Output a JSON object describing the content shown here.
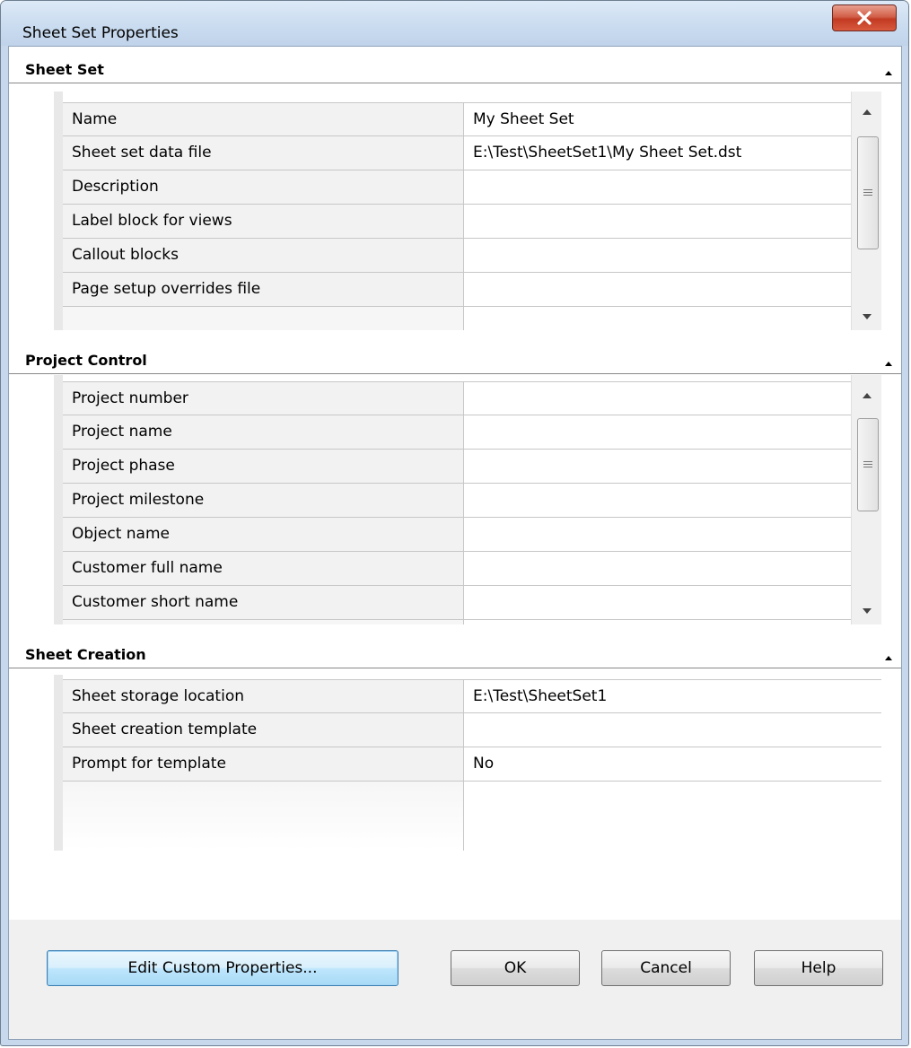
{
  "window": {
    "title": "Sheet Set Properties"
  },
  "sections": {
    "sheet_set": {
      "title": "Sheet Set",
      "rows": [
        {
          "name": "Name",
          "value": "My Sheet Set"
        },
        {
          "name": "Sheet set data file",
          "value": "E:\\Test\\SheetSet1\\My Sheet Set.dst"
        },
        {
          "name": "Description",
          "value": ""
        },
        {
          "name": "Label block for views",
          "value": ""
        },
        {
          "name": "Callout blocks",
          "value": ""
        },
        {
          "name": "Page setup overrides file",
          "value": ""
        }
      ]
    },
    "project_control": {
      "title": "Project Control",
      "rows": [
        {
          "name": "Project number",
          "value": ""
        },
        {
          "name": "Project name",
          "value": ""
        },
        {
          "name": "Project phase",
          "value": ""
        },
        {
          "name": "Project milestone",
          "value": ""
        },
        {
          "name": "Object name",
          "value": ""
        },
        {
          "name": "Customer full name",
          "value": ""
        },
        {
          "name": "Customer short name",
          "value": ""
        }
      ]
    },
    "sheet_creation": {
      "title": "Sheet Creation",
      "rows": [
        {
          "name": "Sheet storage location",
          "value": "E:\\Test\\SheetSet1"
        },
        {
          "name": "Sheet creation template",
          "value": ""
        },
        {
          "name": "Prompt for template",
          "value": "No"
        }
      ]
    }
  },
  "buttons": {
    "edit_custom": "Edit Custom Properties...",
    "ok": "OK",
    "cancel": "Cancel",
    "help": "Help"
  },
  "icons": {
    "close": "close-x-icon",
    "collapse": "collapse-triangle-icon",
    "scroll_up": "scroll-up-arrow-icon",
    "scroll_down": "scroll-down-arrow-icon"
  }
}
